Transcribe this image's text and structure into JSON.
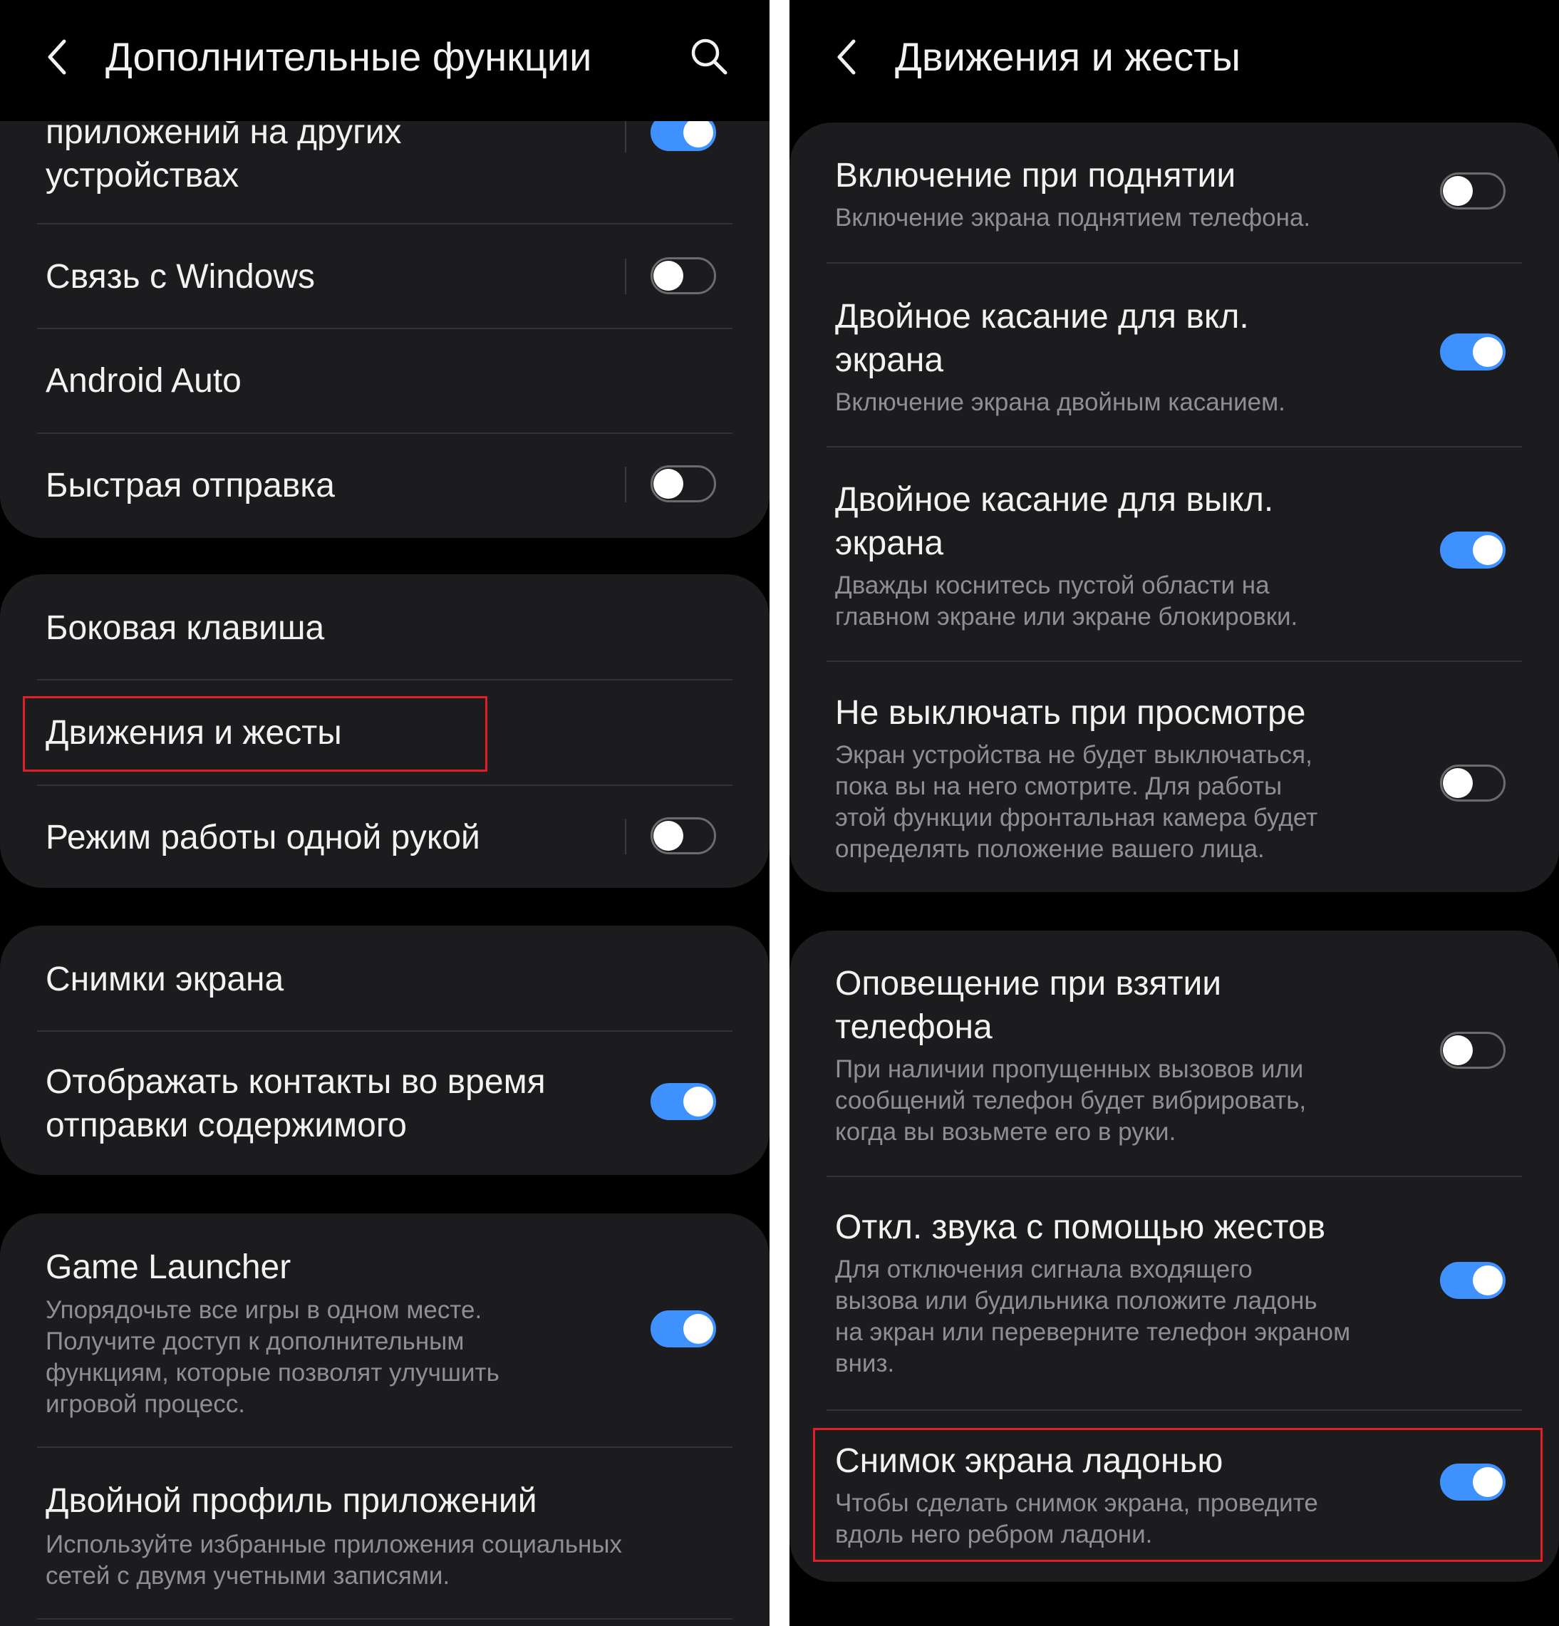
{
  "left": {
    "header": {
      "title": "Дополнительные функции"
    },
    "items": {
      "other_devices": {
        "title_line1": "приложений на других",
        "title_line2": "устройствах",
        "toggle": true
      },
      "link_windows": {
        "title": "Связь с Windows",
        "toggle": false
      },
      "android_auto": {
        "title": "Android Auto"
      },
      "quick_share": {
        "title": "Быстрая отправка",
        "toggle": false
      },
      "side_key": {
        "title": "Боковая клавиша"
      },
      "motions": {
        "title": "Движения и жесты"
      },
      "one_hand": {
        "title": "Режим работы одной рукой",
        "toggle": false
      },
      "screenshots": {
        "title": "Снимки экрана"
      },
      "show_contacts": {
        "title_line1": "Отображать контакты во время",
        "title_line2": "отправки содержимого",
        "toggle": true
      },
      "game_launcher": {
        "title": "Game Launcher",
        "desc_line1": "Упорядочьте все игры в одном месте.",
        "desc_line2": "Получите доступ к дополнительным",
        "desc_line3": "функциям, которые позволят улучшить",
        "desc_line4": "игровой процесс.",
        "toggle": true
      },
      "dual_messenger": {
        "title": "Двойной профиль приложений",
        "desc_line1": "Используйте избранные приложения социальных",
        "desc_line2": "сетей с двумя учетными записями."
      }
    }
  },
  "right": {
    "header": {
      "title": "Движения и жесты"
    },
    "items": {
      "lift_to_wake": {
        "title": "Включение при поднятии",
        "desc_line1": "Включение экрана поднятием телефона.",
        "toggle": false
      },
      "double_tap_on": {
        "title_line1": "Двойное касание для вкл.",
        "title_line2": "экрана",
        "desc_line1": "Включение экрана двойным касанием.",
        "toggle": true
      },
      "double_tap_off": {
        "title_line1": "Двойное касание для выкл.",
        "title_line2": "экрана",
        "desc_line1": "Дважды коснитесь пустой области на",
        "desc_line2": "главном экране или экране блокировки.",
        "toggle": true
      },
      "smart_stay": {
        "title": "Не выключать при просмотре",
        "desc_line1": "Экран устройства не будет выключаться,",
        "desc_line2": "пока вы на него смотрите. Для работы",
        "desc_line3": "этой функции фронтальная камера будет",
        "desc_line4": "определять положение вашего лица.",
        "toggle": false
      },
      "smart_alert": {
        "title_line1": "Оповещение при взятии",
        "title_line2": "телефона",
        "desc_line1": "При наличии пропущенных вызовов или",
        "desc_line2": "сообщений телефон будет вибрировать,",
        "desc_line3": "когда вы возьмете его в руки.",
        "toggle": false
      },
      "easy_mute": {
        "title": "Откл. звука с помощью жестов",
        "desc_line1": "Для отключения сигнала входящего",
        "desc_line2": "вызова или будильника положите ладонь",
        "desc_line3": "на экран или переверните телефон экраном",
        "desc_line4": "вниз.",
        "toggle": true
      },
      "palm_swipe": {
        "title": "Снимок экрана ладонью",
        "desc_line1": "Чтобы сделать снимок экрана, проведите",
        "desc_line2": "вдоль него ребром ладони.",
        "toggle": true
      }
    }
  },
  "colors": {
    "background": "#000000",
    "card": "#1c1c1e",
    "text_primary": "#f2f2f2",
    "text_secondary": "#8e8e93",
    "toggle_on": "#3e91ff",
    "highlight": "#e01e26"
  },
  "icons": {
    "back": "back-chevron-icon",
    "search": "search-icon"
  }
}
